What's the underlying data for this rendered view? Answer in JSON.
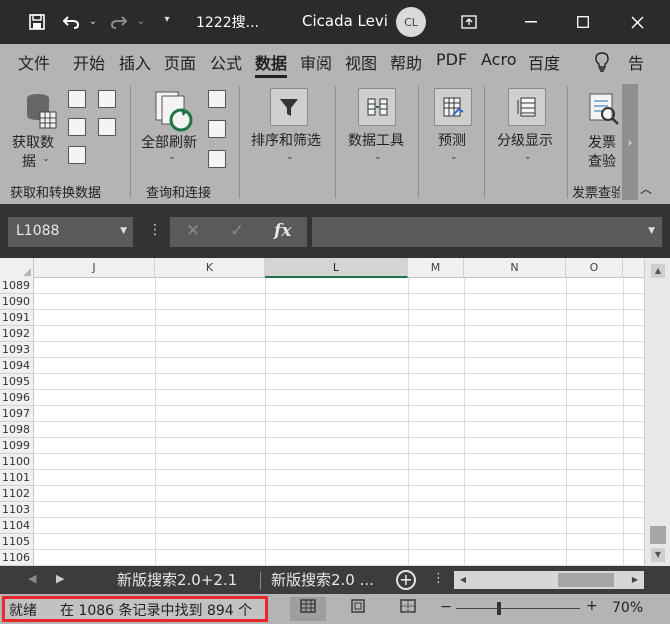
{
  "titlebar": {
    "doc_title": "1222搜...",
    "user_name": "Cicada Levi",
    "avatar_initials": "CL"
  },
  "tabs": [
    "文件",
    "开始",
    "插入",
    "页面",
    "公式",
    "数据",
    "审阅",
    "视图",
    "帮助",
    "PDF",
    "Acro",
    "百度",
    "告"
  ],
  "active_tab": "数据",
  "ribbon": {
    "get_data": "获取数",
    "get_data_2": "据",
    "refresh_all": "全部刷新",
    "sort_filter": "排序和筛选",
    "data_tools": "数据工具",
    "forecast": "预测",
    "outline": "分级显示",
    "invoice": "发票",
    "invoice_2": "查验",
    "group_get_transform": "获取和转换数据",
    "group_query": "查询和连接",
    "group_invoice": "发票查验"
  },
  "formula_bar": {
    "namebox": "L1088",
    "fx_label": "fx",
    "cancel_label": "✕",
    "enter_label": "✓"
  },
  "grid": {
    "columns": [
      "J",
      "K",
      "L",
      "M",
      "N",
      "O"
    ],
    "selected_column": "L",
    "rows": [
      "1089",
      "1090",
      "1091",
      "1092",
      "1093",
      "1094",
      "1095",
      "1096",
      "1097",
      "1098",
      "1099",
      "1100",
      "1101",
      "1102",
      "1103",
      "1104",
      "1105",
      "1106"
    ]
  },
  "sheets": {
    "tab1": "新版搜索2.0+2.1",
    "tab2": "新版搜索2.0 ...",
    "add_label": "+"
  },
  "statusbar": {
    "ready": "就绪",
    "find_result": "在 1086 条记录中找到 894 个",
    "zoom": "70%",
    "zoom_minus": "−",
    "zoom_plus": "+"
  },
  "colors": {
    "accent_green": "#217346",
    "highlight_red": "#e8292b"
  }
}
